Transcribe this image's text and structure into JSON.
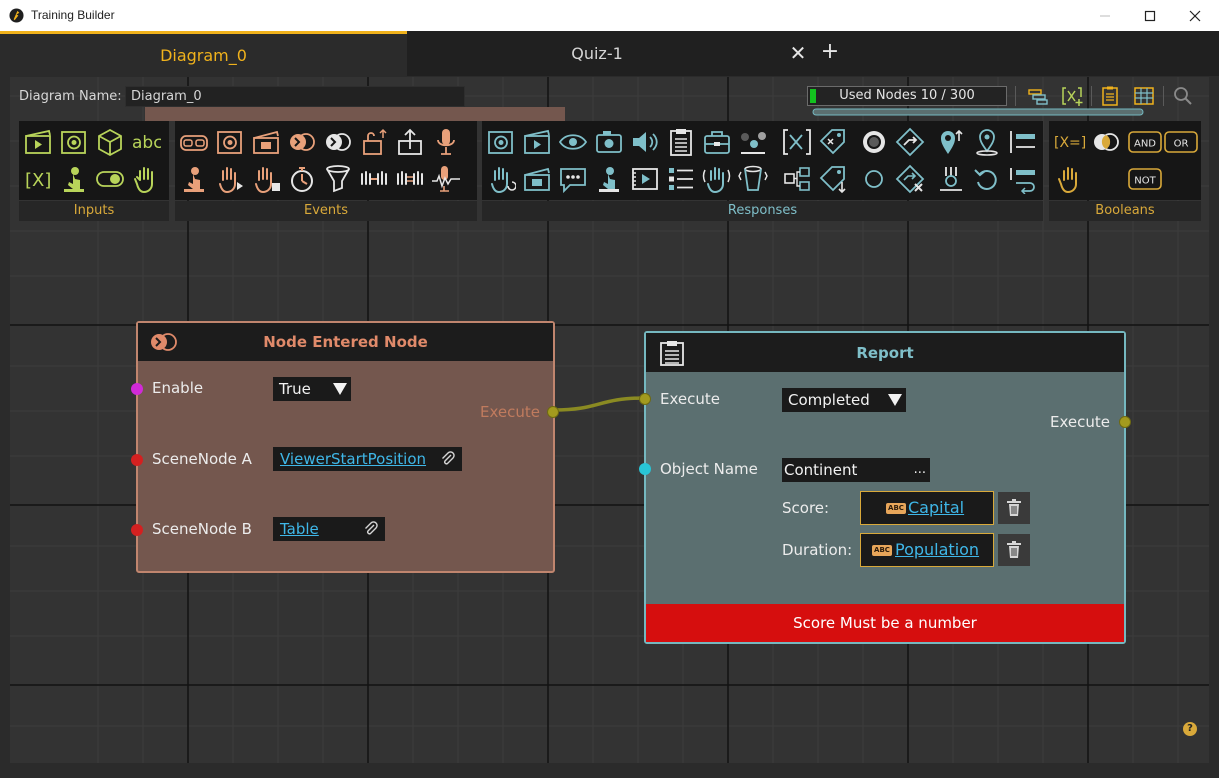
{
  "window": {
    "title": "Training Builder"
  },
  "tabs": [
    {
      "label": "Diagram_0",
      "active": true
    },
    {
      "label": "Quiz-1",
      "active": false
    }
  ],
  "tab_controls": {
    "close_glyph": "✕",
    "add_glyph": "+"
  },
  "toolbar": {
    "diagram_name_label": "Diagram Name:",
    "diagram_name_value": "Diagram_0",
    "used_nodes_text": "Used Nodes 10 / 300",
    "used_nodes_fraction": 0.033,
    "icons": [
      "layers-icon",
      "add-variable-icon",
      "clipboard-icon",
      "table-view-icon",
      "search-icon"
    ]
  },
  "palette": {
    "groups": [
      {
        "label": "Inputs"
      },
      {
        "label": "Events"
      },
      {
        "label": "Responses"
      },
      {
        "label": "Booleans"
      }
    ],
    "text_icons": {
      "abc": "abc",
      "var": "[X]",
      "and": "AND",
      "or": "OR",
      "not": "NOT",
      "xeq": "[X=]"
    }
  },
  "nodes": {
    "node_entered": {
      "title": "Node Entered Node",
      "enable_label": "Enable",
      "enable_value": "True",
      "scenenode_a_label": "SceneNode A",
      "scenenode_a_value": "ViewerStartPosition",
      "scenenode_b_label": "SceneNode B",
      "scenenode_b_value": "Table",
      "execute_out_label": "Execute"
    },
    "report": {
      "title": "Report",
      "execute_in_label": "Execute",
      "execute_value": "Completed",
      "execute_out_label": "Execute",
      "object_name_label": "Object Name",
      "object_name_value": "Continent",
      "object_name_more": "...",
      "score_label": "Score:",
      "score_value": "Capital",
      "duration_label": "Duration:",
      "duration_value": "Population",
      "tag_badge": "ABC",
      "error_text": "Score Must be a number"
    }
  },
  "help_glyph": "?",
  "colors": {
    "accent": "#f0b21c",
    "events_node": "#74574e",
    "report_node": "#5b6f70",
    "error": "#d60e0e",
    "link": "#3fb7e8"
  }
}
